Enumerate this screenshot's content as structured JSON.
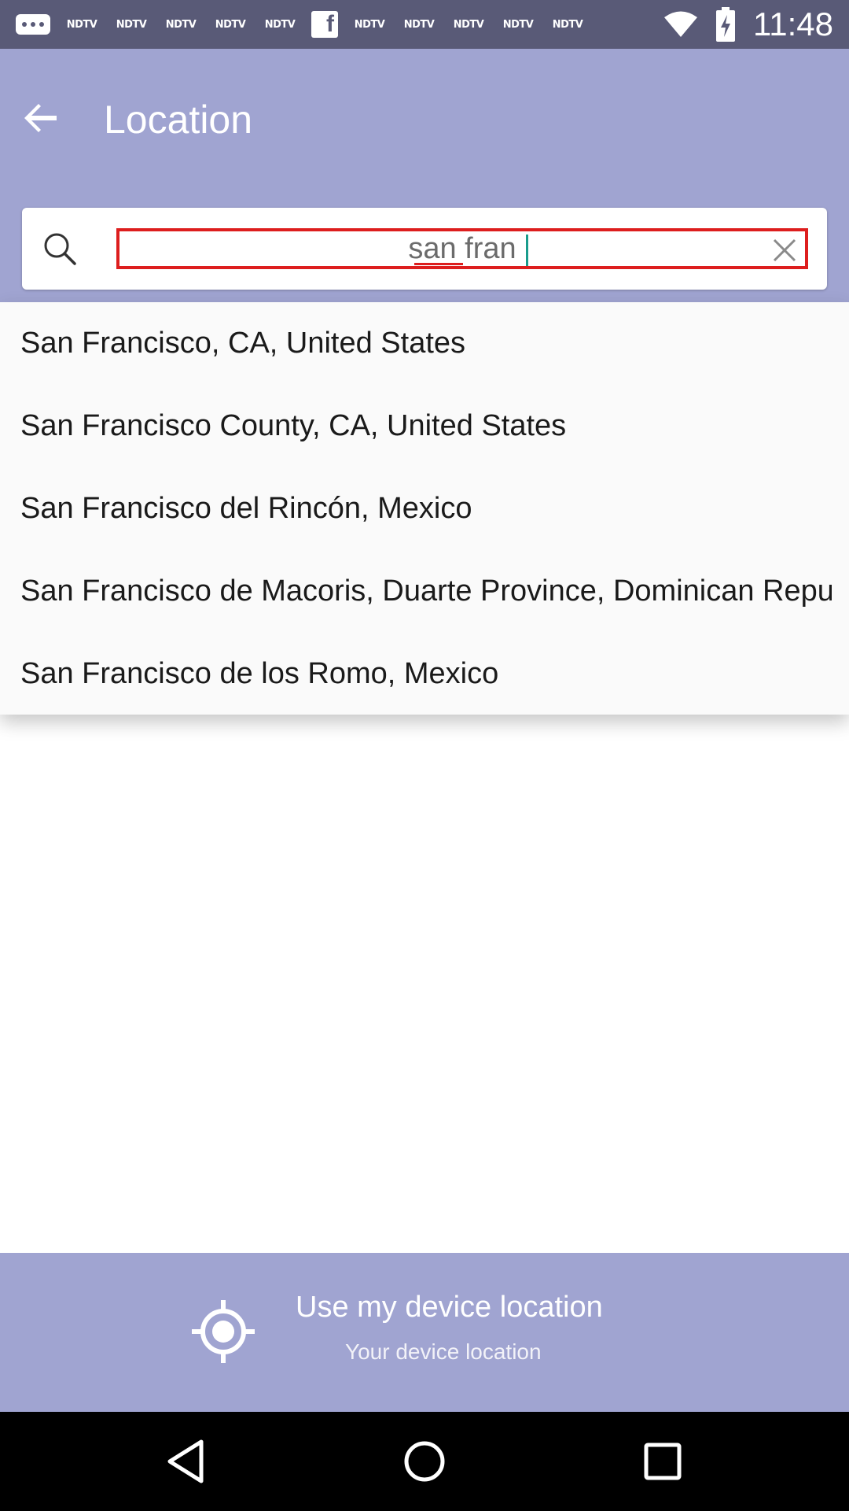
{
  "status_bar": {
    "notification_labels": [
      "NDTV",
      "NDTV",
      "NDTV",
      "NDTV",
      "NDTV",
      "NDTV",
      "NDTV",
      "NDTV",
      "NDTV",
      "NDTV"
    ],
    "time": "11:48"
  },
  "header": {
    "title": "Location"
  },
  "search": {
    "value": "san fran"
  },
  "suggestions": [
    {
      "label": "San Francisco, CA, United States"
    },
    {
      "label": "San Francisco County, CA, United States"
    },
    {
      "label": "San Francisco del Rincón, Mexico"
    },
    {
      "label": "San Francisco de Macoris, Duarte Province, Dominican Republic"
    },
    {
      "label": "San Francisco de los Romo, Mexico"
    }
  ],
  "device_location": {
    "title": "Use my device location",
    "subtitle": "Your device location"
  },
  "colors": {
    "header_bg": "#a0a4d1",
    "status_bar_bg": "#595a77",
    "highlight_border": "#dd1e1e",
    "caret": "#1a9c8c"
  }
}
